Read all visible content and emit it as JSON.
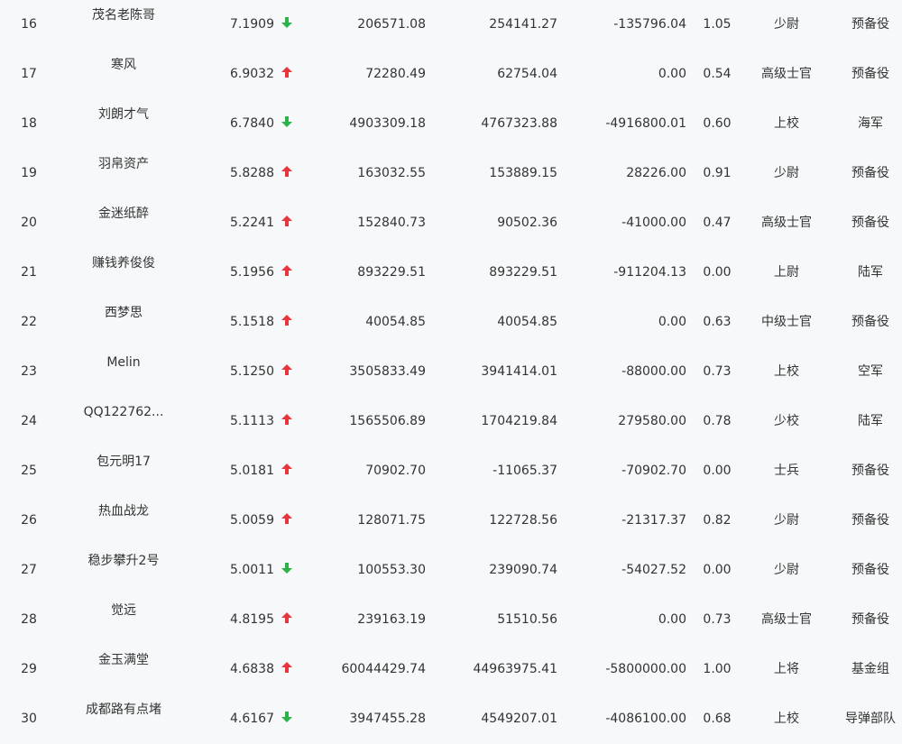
{
  "colors": {
    "up": "#e8353b",
    "down": "#2bb34a",
    "text": "#333333",
    "background": "#f6f8fa"
  },
  "rows": [
    {
      "rank": "16",
      "name": "茂名老陈哥",
      "score": "7.1909",
      "trend": "down",
      "trend_icon": "arrow-down-icon",
      "v1": "206571.08",
      "v2": "254141.27",
      "v3": "-135796.04",
      "ratio": "1.05",
      "title": "少尉",
      "unit": "预备役"
    },
    {
      "rank": "17",
      "name": "寒风",
      "score": "6.9032",
      "trend": "up",
      "trend_icon": "arrow-up-icon",
      "v1": "72280.49",
      "v2": "62754.04",
      "v3": "0.00",
      "ratio": "0.54",
      "title": "高级士官",
      "unit": "预备役"
    },
    {
      "rank": "18",
      "name": "刘朗才气",
      "score": "6.7840",
      "trend": "down",
      "trend_icon": "arrow-down-icon",
      "v1": "4903309.18",
      "v2": "4767323.88",
      "v3": "-4916800.01",
      "ratio": "0.60",
      "title": "上校",
      "unit": "海军"
    },
    {
      "rank": "19",
      "name": "羽帛资产",
      "score": "5.8288",
      "trend": "up",
      "trend_icon": "arrow-up-icon",
      "v1": "163032.55",
      "v2": "153889.15",
      "v3": "28226.00",
      "ratio": "0.91",
      "title": "少尉",
      "unit": "预备役"
    },
    {
      "rank": "20",
      "name": "金迷纸醉",
      "score": "5.2241",
      "trend": "up",
      "trend_icon": "arrow-up-icon",
      "v1": "152840.73",
      "v2": "90502.36",
      "v3": "-41000.00",
      "ratio": "0.47",
      "title": "高级士官",
      "unit": "预备役"
    },
    {
      "rank": "21",
      "name": "赚钱养俊俊",
      "score": "5.1956",
      "trend": "up",
      "trend_icon": "arrow-up-icon",
      "v1": "893229.51",
      "v2": "893229.51",
      "v3": "-911204.13",
      "ratio": "0.00",
      "title": "上尉",
      "unit": "陆军"
    },
    {
      "rank": "22",
      "name": "西梦思",
      "score": "5.1518",
      "trend": "up",
      "trend_icon": "arrow-up-icon",
      "v1": "40054.85",
      "v2": "40054.85",
      "v3": "0.00",
      "ratio": "0.63",
      "title": "中级士官",
      "unit": "预备役"
    },
    {
      "rank": "23",
      "name": "Melin",
      "score": "5.1250",
      "trend": "up",
      "trend_icon": "arrow-up-icon",
      "v1": "3505833.49",
      "v2": "3941414.01",
      "v3": "-88000.00",
      "ratio": "0.73",
      "title": "上校",
      "unit": "空军"
    },
    {
      "rank": "24",
      "name": "QQ122762...",
      "score": "5.1113",
      "trend": "up",
      "trend_icon": "arrow-up-icon",
      "v1": "1565506.89",
      "v2": "1704219.84",
      "v3": "279580.00",
      "ratio": "0.78",
      "title": "少校",
      "unit": "陆军"
    },
    {
      "rank": "25",
      "name": "包元明17",
      "score": "5.0181",
      "trend": "up",
      "trend_icon": "arrow-up-icon",
      "v1": "70902.70",
      "v2": "-11065.37",
      "v3": "-70902.70",
      "ratio": "0.00",
      "title": "士兵",
      "unit": "预备役"
    },
    {
      "rank": "26",
      "name": "热血战龙",
      "score": "5.0059",
      "trend": "up",
      "trend_icon": "arrow-up-icon",
      "v1": "128071.75",
      "v2": "122728.56",
      "v3": "-21317.37",
      "ratio": "0.82",
      "title": "少尉",
      "unit": "预备役"
    },
    {
      "rank": "27",
      "name": "稳步攀升2号",
      "score": "5.0011",
      "trend": "down",
      "trend_icon": "arrow-down-icon",
      "v1": "100553.30",
      "v2": "239090.74",
      "v3": "-54027.52",
      "ratio": "0.00",
      "title": "少尉",
      "unit": "预备役"
    },
    {
      "rank": "28",
      "name": "觉远",
      "score": "4.8195",
      "trend": "up",
      "trend_icon": "arrow-up-icon",
      "v1": "239163.19",
      "v2": "51510.56",
      "v3": "0.00",
      "ratio": "0.73",
      "title": "高级士官",
      "unit": "预备役"
    },
    {
      "rank": "29",
      "name": "金玉满堂",
      "score": "4.6838",
      "trend": "up",
      "trend_icon": "arrow-up-icon",
      "v1": "60044429.74",
      "v2": "44963975.41",
      "v3": "-5800000.00",
      "ratio": "1.00",
      "title": "上将",
      "unit": "基金组"
    },
    {
      "rank": "30",
      "name": "成都路有点堵",
      "score": "4.6167",
      "trend": "down",
      "trend_icon": "arrow-down-icon",
      "v1": "3947455.28",
      "v2": "4549207.01",
      "v3": "-4086100.00",
      "ratio": "0.68",
      "title": "上校",
      "unit": "导弹部队"
    }
  ]
}
